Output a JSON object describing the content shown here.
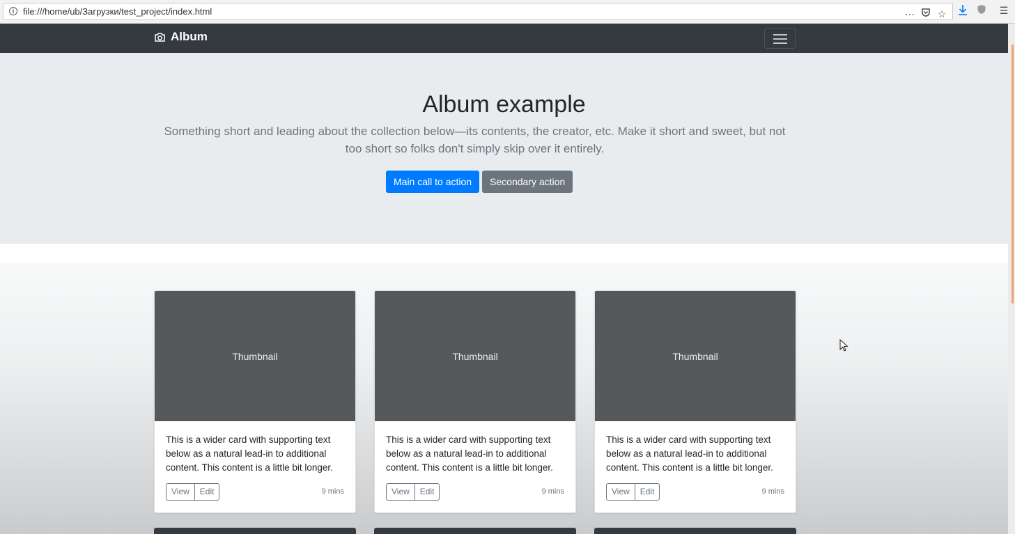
{
  "browser": {
    "url": "file:///home/ub/Загрузки/test_project/index.html"
  },
  "navbar": {
    "brand": "Album"
  },
  "hero": {
    "title": "Album example",
    "lead": "Something short and leading about the collection below—its contents, the creator, etc. Make it short and sweet, but not too short so folks don't simply skip over it entirely.",
    "primary_button": "Main call to action",
    "secondary_button": "Secondary action"
  },
  "cards": [
    {
      "thumbnail": "Thumbnail",
      "text": "This is a wider card with supporting text below as a natural lead-in to additional content. This content is a little bit longer.",
      "view": "View",
      "edit": "Edit",
      "time": "9 mins"
    },
    {
      "thumbnail": "Thumbnail",
      "text": "This is a wider card with supporting text below as a natural lead-in to additional content. This content is a little bit longer.",
      "view": "View",
      "edit": "Edit",
      "time": "9 mins"
    },
    {
      "thumbnail": "Thumbnail",
      "text": "This is a wider card with supporting text below as a natural lead-in to additional content. This content is a little bit longer.",
      "view": "View",
      "edit": "Edit",
      "time": "9 mins"
    }
  ],
  "colors": {
    "navbar": "#343a40",
    "primary": "#007bff",
    "secondary": "#6c757d",
    "jumbotron": "#e9ecef",
    "thumbnail": "#55595c"
  }
}
